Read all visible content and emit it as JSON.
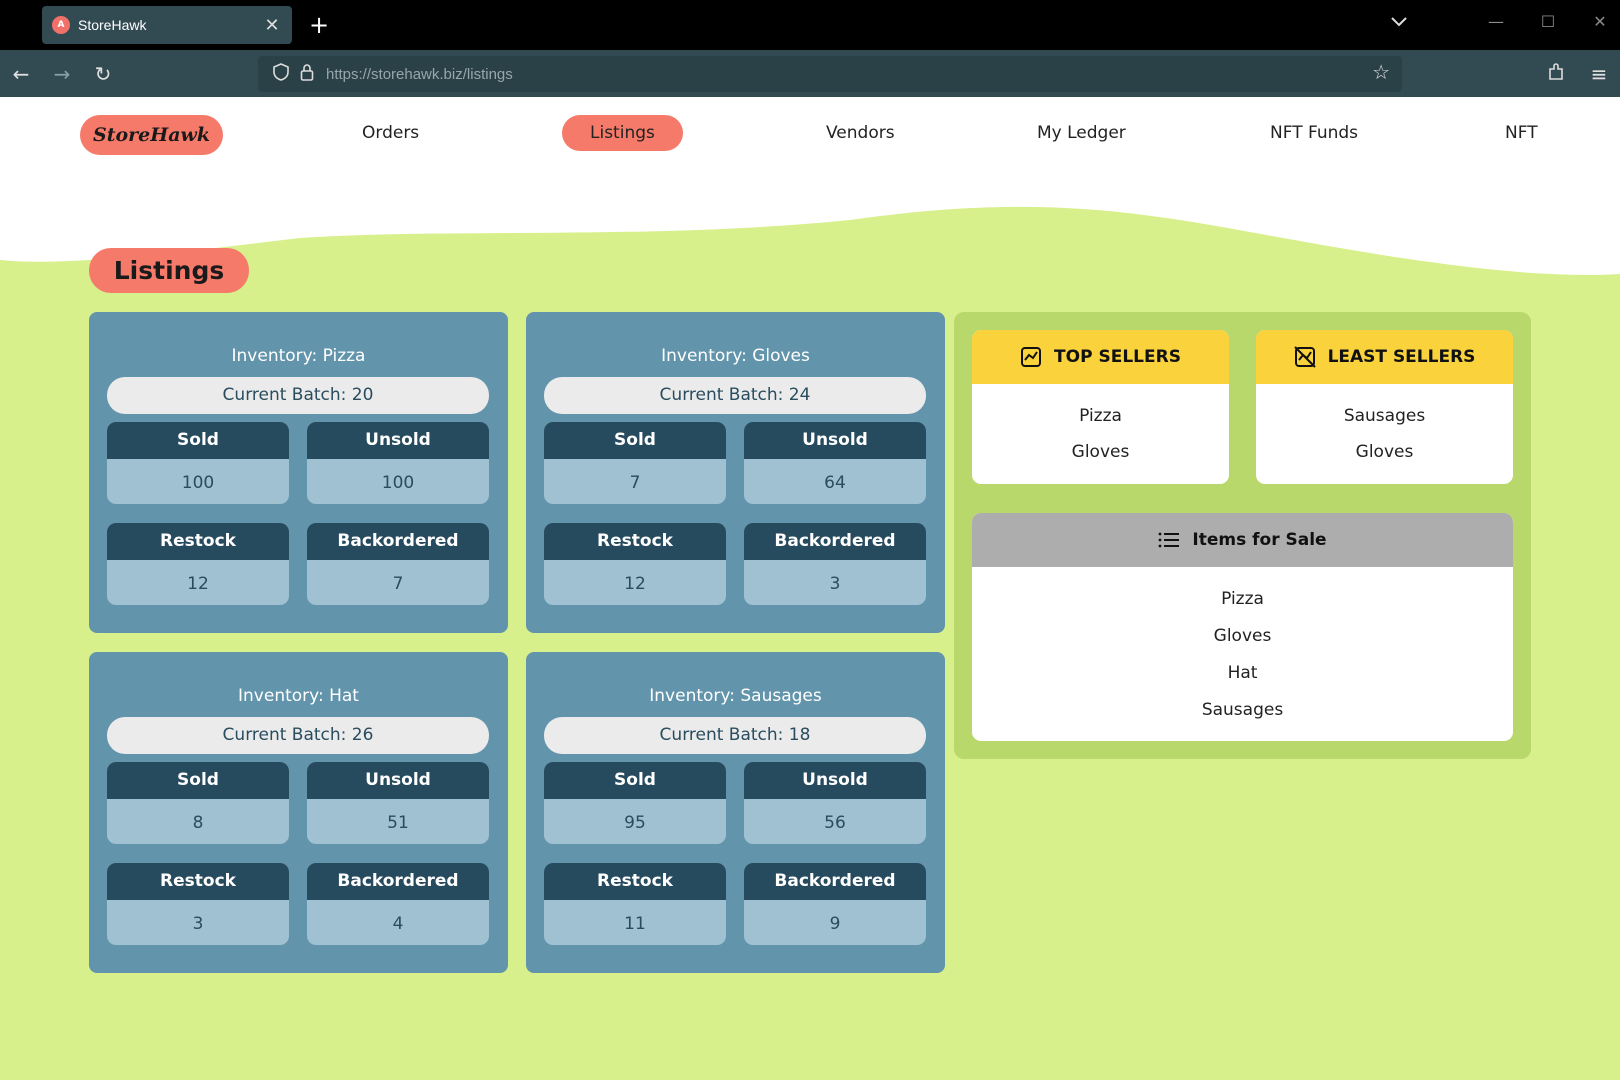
{
  "browser": {
    "tab_title": "StoreHawk",
    "tab_favicon_text": "A",
    "url_host": "https://storehawk.biz",
    "url_path": "/listings"
  },
  "header": {
    "logo": "StoreHawk",
    "menu": [
      "Orders",
      "Listings",
      "Vendors",
      "My Ledger",
      "NFT Funds",
      "NFT"
    ],
    "active": "Listings"
  },
  "page": {
    "title": "Listings"
  },
  "inventory": [
    {
      "title": "Inventory: Pizza",
      "batch": "Current Batch: 20",
      "sold_label": "Sold",
      "sold": "100",
      "unsold_label": "Unsold",
      "unsold": "100",
      "restock_label": "Restock",
      "restock": "12",
      "backordered_label": "Backordered",
      "backordered": "7"
    },
    {
      "title": "Inventory: Gloves",
      "batch": "Current Batch: 24",
      "sold_label": "Sold",
      "sold": "7",
      "unsold_label": "Unsold",
      "unsold": "64",
      "restock_label": "Restock",
      "restock": "12",
      "backordered_label": "Backordered",
      "backordered": "3"
    },
    {
      "title": "Inventory: Hat",
      "batch": "Current Batch: 26",
      "sold_label": "Sold",
      "sold": "8",
      "unsold_label": "Unsold",
      "unsold": "51",
      "restock_label": "Restock",
      "restock": "3",
      "backordered_label": "Backordered",
      "backordered": "4"
    },
    {
      "title": "Inventory: Sausages",
      "batch": "Current Batch: 18",
      "sold_label": "Sold",
      "sold": "95",
      "unsold_label": "Unsold",
      "unsold": "56",
      "restock_label": "Restock",
      "restock": "11",
      "backordered_label": "Backordered",
      "backordered": "9"
    }
  ],
  "top_sellers": {
    "title": "TOP SELLERS",
    "items": [
      "Pizza",
      "Gloves"
    ],
    "icon": "chart-icon"
  },
  "least_sellers": {
    "title": "LEAST SELLERS",
    "items": [
      "Sausages",
      "Gloves"
    ],
    "icon": "chart-off-icon"
  },
  "items_for_sale": {
    "title": "Items for Sale",
    "items": [
      "Pizza",
      "Gloves",
      "Hat",
      "Sausages"
    ],
    "icon": "list-icon"
  },
  "colors": {
    "background": "#d8f08c",
    "accent": "#f57a6a",
    "card": "#6294ab",
    "card_dark": "#264a5e",
    "yellow": "#fad23c"
  }
}
